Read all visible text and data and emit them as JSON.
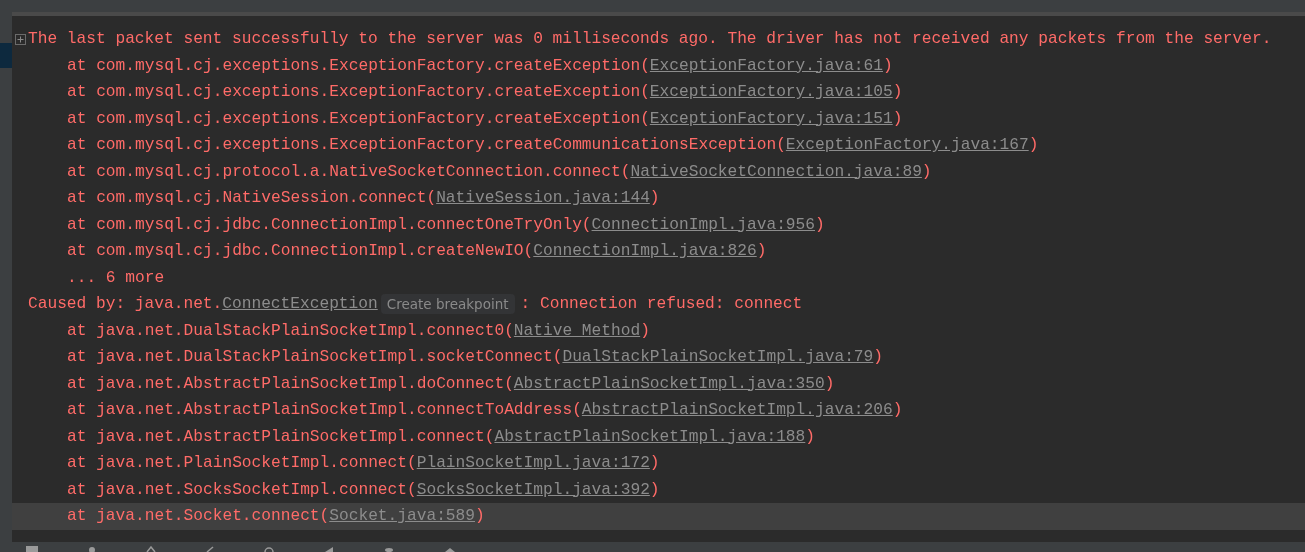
{
  "console": {
    "lines": [
      {
        "kind": "message",
        "text": "The last packet sent successfully to the server was 0 milliseconds ago. The driver has not received any packets from the server.",
        "highlighted": false
      },
      {
        "kind": "frame",
        "text": "at com.mysql.cj.exceptions.ExceptionFactory.createException(",
        "link": "ExceptionFactory.java:61",
        "tail": ")",
        "highlighted": false
      },
      {
        "kind": "frame",
        "text": "at com.mysql.cj.exceptions.ExceptionFactory.createException(",
        "link": "ExceptionFactory.java:105",
        "tail": ")",
        "highlighted": false
      },
      {
        "kind": "frame",
        "text": "at com.mysql.cj.exceptions.ExceptionFactory.createException(",
        "link": "ExceptionFactory.java:151",
        "tail": ")",
        "highlighted": false
      },
      {
        "kind": "frame",
        "text": "at com.mysql.cj.exceptions.ExceptionFactory.createCommunicationsException(",
        "link": "ExceptionFactory.java:167",
        "tail": ")",
        "highlighted": false
      },
      {
        "kind": "frame",
        "text": "at com.mysql.cj.protocol.a.NativeSocketConnection.connect(",
        "link": "NativeSocketConnection.java:89",
        "tail": ")",
        "highlighted": false
      },
      {
        "kind": "frame",
        "text": "at com.mysql.cj.NativeSession.connect(",
        "link": "NativeSession.java:144",
        "tail": ")",
        "highlighted": false
      },
      {
        "kind": "frame",
        "text": "at com.mysql.cj.jdbc.ConnectionImpl.connectOneTryOnly(",
        "link": "ConnectionImpl.java:956",
        "tail": ")",
        "highlighted": false
      },
      {
        "kind": "frame",
        "text": "at com.mysql.cj.jdbc.ConnectionImpl.createNewIO(",
        "link": "ConnectionImpl.java:826",
        "tail": ")",
        "highlighted": false
      },
      {
        "kind": "more",
        "text": "... 6 more",
        "highlighted": false
      },
      {
        "kind": "caused",
        "text": "Caused by: java.net.",
        "link": "ConnectException",
        "badge": "Create breakpoint",
        "tail": ": Connection refused: connect",
        "highlighted": false
      },
      {
        "kind": "frame",
        "text": "at java.net.DualStackPlainSocketImpl.connect0(",
        "link": "Native Method",
        "tail": ")",
        "highlighted": false
      },
      {
        "kind": "frame",
        "text": "at java.net.DualStackPlainSocketImpl.socketConnect(",
        "link": "DualStackPlainSocketImpl.java:79",
        "tail": ")",
        "highlighted": false
      },
      {
        "kind": "frame",
        "text": "at java.net.AbstractPlainSocketImpl.doConnect(",
        "link": "AbstractPlainSocketImpl.java:350",
        "tail": ")",
        "highlighted": false
      },
      {
        "kind": "frame",
        "text": "at java.net.AbstractPlainSocketImpl.connectToAddress(",
        "link": "AbstractPlainSocketImpl.java:206",
        "tail": ")",
        "highlighted": false
      },
      {
        "kind": "frame",
        "text": "at java.net.AbstractPlainSocketImpl.connect(",
        "link": "AbstractPlainSocketImpl.java:188",
        "tail": ")",
        "highlighted": false
      },
      {
        "kind": "frame",
        "text": "at java.net.PlainSocketImpl.connect(",
        "link": "PlainSocketImpl.java:172",
        "tail": ")",
        "highlighted": false
      },
      {
        "kind": "frame",
        "text": "at java.net.SocksSocketImpl.connect(",
        "link": "SocksSocketImpl.java:392",
        "tail": ")",
        "highlighted": false
      },
      {
        "kind": "frame",
        "text": "at java.net.Socket.connect(",
        "link": "Socket.java:589",
        "tail": ")",
        "highlighted": true
      }
    ]
  }
}
